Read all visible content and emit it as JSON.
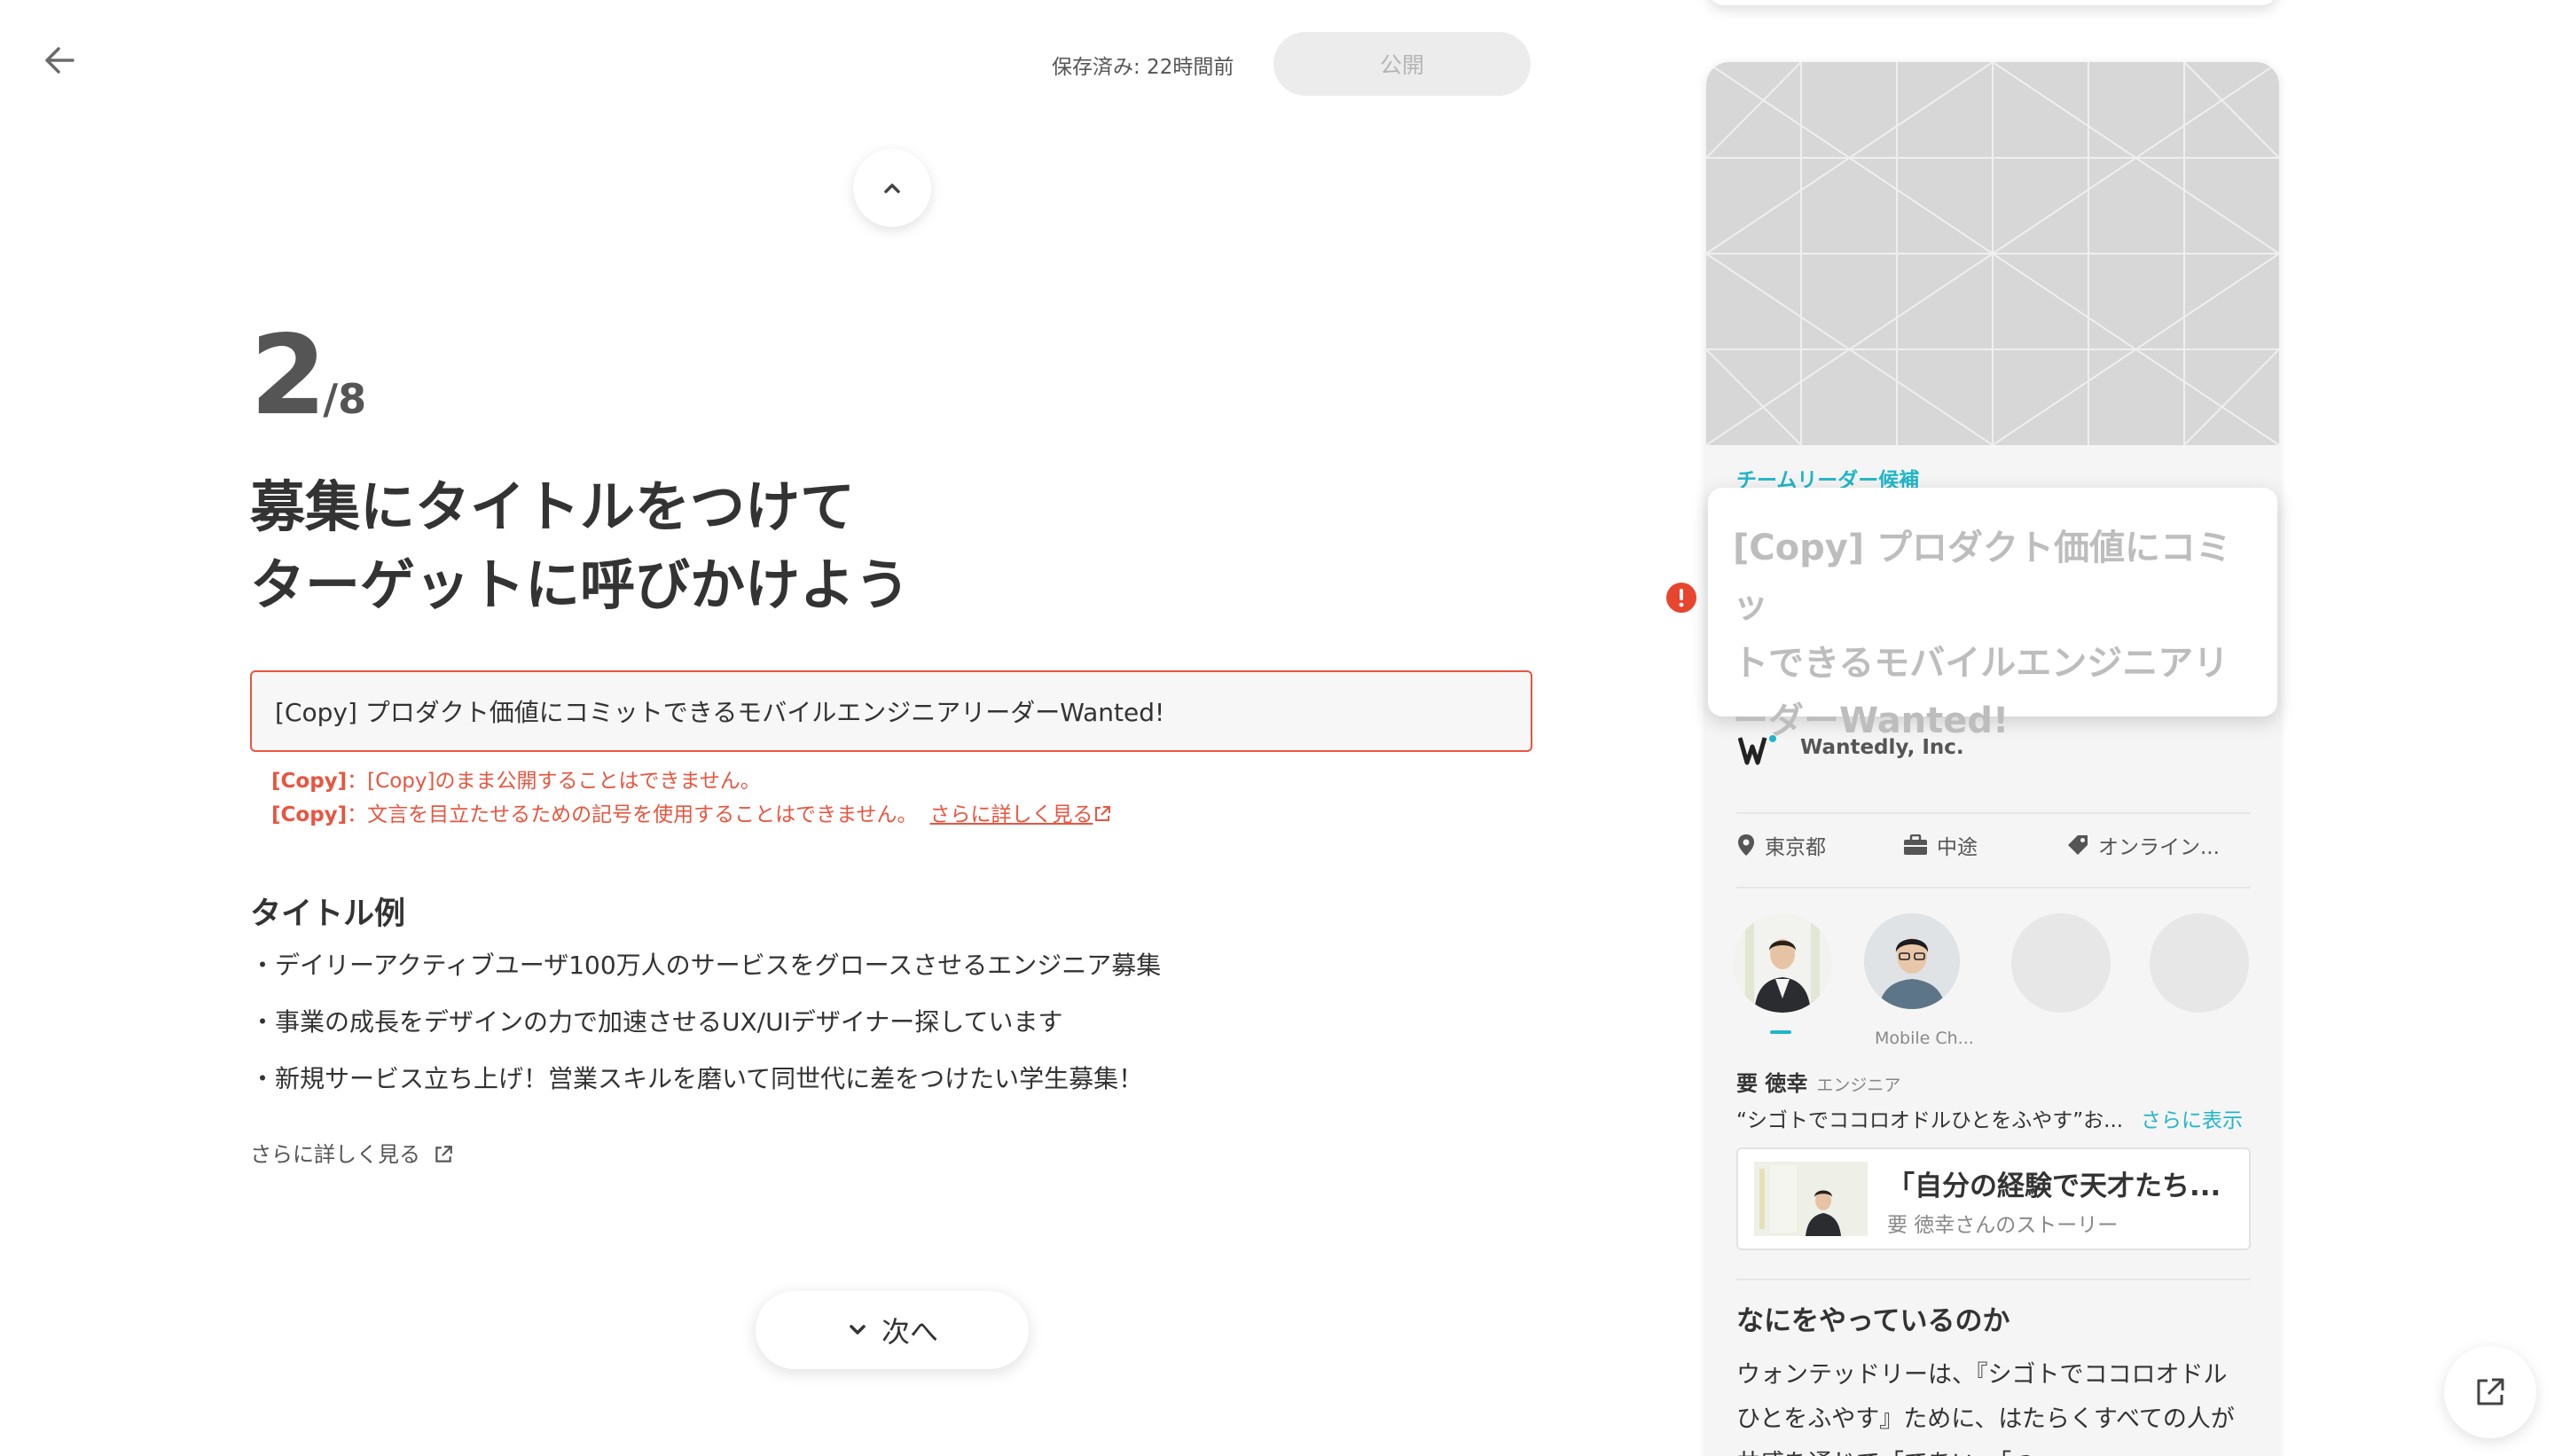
{
  "header": {
    "saved_status": "保存済み: 22時間前",
    "publish_label": "公開"
  },
  "step": {
    "current": "2",
    "total": "/8"
  },
  "heading": {
    "line1": "募集にタイトルをつけて",
    "line2": "ターゲットに呼びかけよう"
  },
  "title_input": {
    "value": "[Copy] プロダクト価値にコミットできるモバイルエンジニアリーダーWanted!"
  },
  "errors": [
    {
      "tag": "[Copy]",
      "message": "：[Copy]のまま公開することはできません。"
    },
    {
      "tag": "[Copy]",
      "message": "：文言を目立たせるための記号を使用することはできません。",
      "link": "さらに詳しく見る"
    }
  ],
  "examples": {
    "heading": "タイトル例",
    "items": [
      "・デイリーアクティブユーザ100万人のサービスをグロースさせるエンジニア募集",
      "・事業の成長をデザインの力で加速させるUX/UIデザイナー探しています",
      "・新規サービス立ち上げ！営業スキルを磨いて同世代に差をつけたい学生募集！"
    ],
    "more_link": "さらに詳しく見る"
  },
  "next_button": {
    "label": "次へ"
  },
  "preview": {
    "tag": "チームリーダー候補",
    "title": "[Copy] プロダクト価値にコミットできるモバイルエンジニアリーダーWanted!",
    "title_lines": [
      "[Copy] プロダクト価値にコミッ",
      "トできるモバイルエンジニアリ",
      "ーダーWanted!"
    ],
    "company": "Wantedly, Inc.",
    "meta": [
      {
        "icon": "location-icon",
        "label": "東京都"
      },
      {
        "icon": "briefcase-icon",
        "label": "中途"
      },
      {
        "icon": "tag-icon",
        "label": "オンライン..."
      }
    ],
    "avatar_caption": "Mobile Ch...",
    "member": {
      "name": "要 徳幸",
      "role": "エンジニア",
      "quote": "“シゴトでココロオドルひとをふやす”お...",
      "show_more": "さらに表示"
    },
    "story": {
      "title": "「自分の経験で天才たち...",
      "subtitle": "要 徳幸さんのストーリー"
    },
    "section": {
      "heading": "なにをやっているのか",
      "body": "ウォンテッドリーは、『シゴトでココロオドルひとをふやす』ために、はたらくすべての人が共感を通じて「であい」「つ"
    }
  },
  "colors": {
    "accent": "#21b6c8",
    "error": "#e8553f",
    "publish_disabled_bg": "#ececec"
  }
}
